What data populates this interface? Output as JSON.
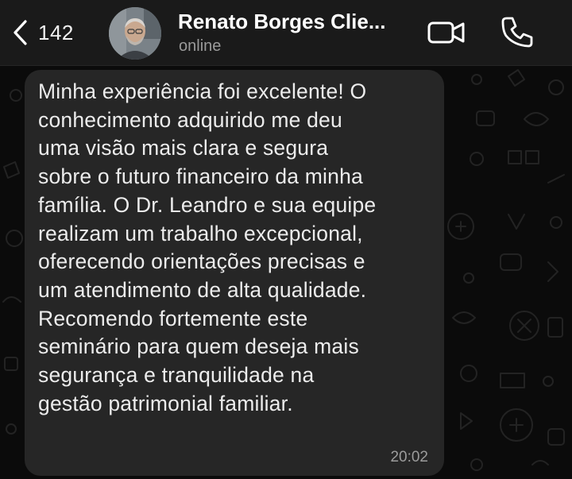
{
  "header": {
    "back_count": "142",
    "contact_name": "Renato Borges Clie...",
    "status": "online"
  },
  "icons": {
    "back": "chevron-left-icon",
    "video": "video-camera-icon",
    "call": "phone-icon"
  },
  "message": {
    "lines": [
      "Minha experiência foi excelente! O",
      "conhecimento adquirido me deu",
      "uma visão mais clara e segura",
      "sobre o futuro financeiro da minha",
      "família. O Dr. Leandro e sua equipe",
      "realizam um trabalho excepcional,",
      "oferecendo orientações precisas e",
      "um atendimento de alta qualidade.",
      "Recomendo fortemente este",
      "seminário para quem deseja mais",
      "segurança e tranquilidade na",
      "gestão patrimonial familiar."
    ],
    "time": "20:02"
  },
  "colors": {
    "header_bg": "#1a1a1a",
    "bubble_bg": "#262626",
    "chat_bg": "#0b0b0b"
  }
}
